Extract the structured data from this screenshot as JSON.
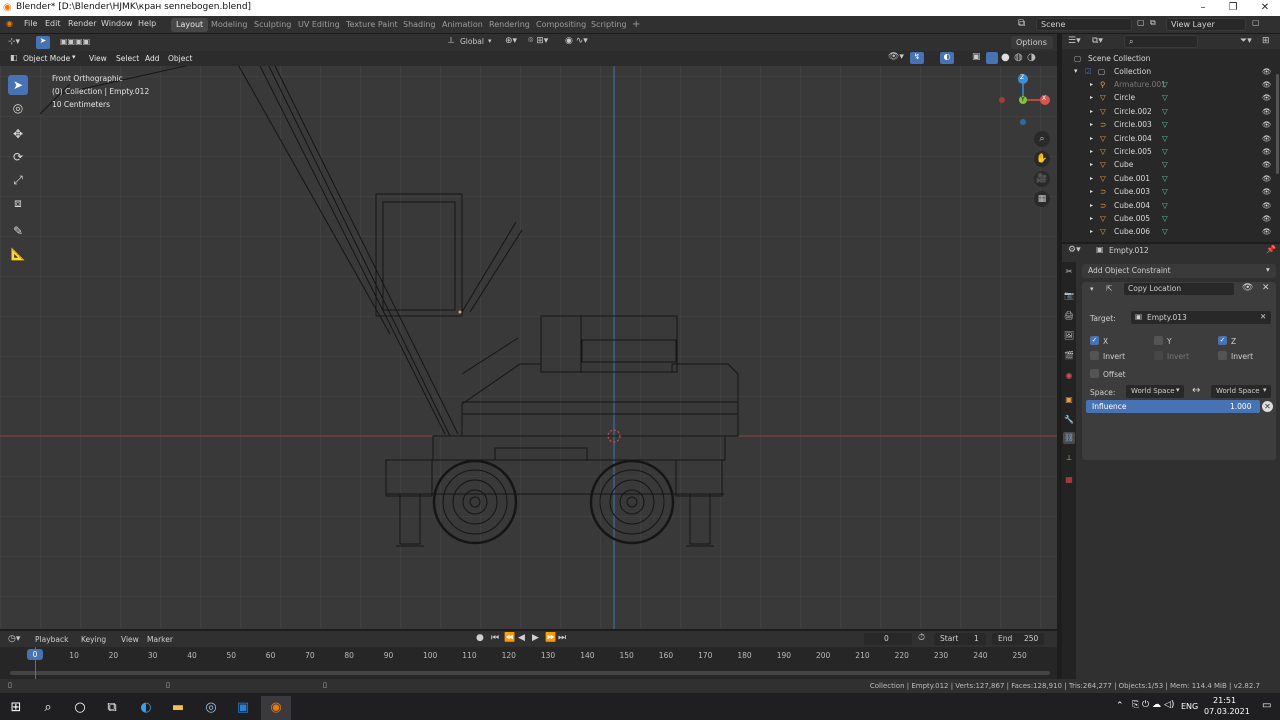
{
  "window": {
    "title": "Blender* [D:\\Blender\\HJMK\\кран sennebogen.blend]",
    "minimize": "–",
    "maximize": "❐",
    "close": "✕"
  },
  "menubar": {
    "items": [
      "File",
      "Edit",
      "Render",
      "Window",
      "Help"
    ],
    "workspaces": [
      "Layout",
      "Modeling",
      "Sculpting",
      "UV Editing",
      "Texture Paint",
      "Shading",
      "Animation",
      "Rendering",
      "Compositing",
      "Scripting"
    ],
    "active_workspace": "Layout",
    "add_workspace": "+",
    "scene": "Scene",
    "view_layer": "View Layer"
  },
  "viewport": {
    "transform_orientation": "Global",
    "options": "Options",
    "mode": "Object Mode",
    "menus": [
      "View",
      "Select",
      "Add",
      "Object"
    ],
    "overlay_lines": [
      "Front Orthographic",
      "(0) Collection | Empty.012",
      "10 Centimeters"
    ],
    "gizmo": {
      "x": "X",
      "y": "Y",
      "z": "Z"
    }
  },
  "outliner": {
    "search_placeholder": "",
    "root": "Scene Collection",
    "collection": "Collection",
    "items": [
      {
        "name": "Armature.001",
        "icon": "armature-icon",
        "dim": true
      },
      {
        "name": "Circle",
        "icon": "mesh-icon"
      },
      {
        "name": "Circle.002",
        "icon": "mesh-icon"
      },
      {
        "name": "Circle.003",
        "icon": "curve-icon"
      },
      {
        "name": "Circle.004",
        "icon": "mesh-icon"
      },
      {
        "name": "Circle.005",
        "icon": "mesh-icon"
      },
      {
        "name": "Cube",
        "icon": "mesh-icon"
      },
      {
        "name": "Cube.001",
        "icon": "mesh-icon"
      },
      {
        "name": "Cube.003",
        "icon": "curve-icon"
      },
      {
        "name": "Cube.004",
        "icon": "curve-icon"
      },
      {
        "name": "Cube.005",
        "icon": "mesh-icon"
      },
      {
        "name": "Cube.006",
        "icon": "mesh-icon"
      }
    ]
  },
  "properties": {
    "object_name": "Empty.012",
    "add_constraint": "Add Object Constraint",
    "constraint": {
      "name": "Copy Location",
      "target_label": "Target:",
      "target": "Empty.013",
      "x": "X",
      "y": "Y",
      "z": "Z",
      "x_checked": true,
      "y_checked": false,
      "z_checked": true,
      "invert": "Invert",
      "offset": "Offset",
      "space_label": "Space:",
      "owner_space": "World Space",
      "target_space": "World Space",
      "influence_label": "Influence",
      "influence": "1.000"
    }
  },
  "timeline": {
    "menus": [
      "Playback",
      "Keying",
      "View",
      "Marker"
    ],
    "current_frame": "0",
    "start_label": "Start",
    "start": "1",
    "end_label": "End",
    "end": "250",
    "ticks": [
      "0",
      "10",
      "20",
      "30",
      "40",
      "50",
      "60",
      "70",
      "80",
      "90",
      "100",
      "110",
      "120",
      "130",
      "140",
      "150",
      "160",
      "170",
      "180",
      "190",
      "200",
      "210",
      "220",
      "230",
      "240",
      "250"
    ]
  },
  "statusbar": {
    "text": "Collection | Empty.012 | Verts:127,867 | Faces:128,910 | Tris:264,277 | Objects:1/53 | Mem: 114.4 MiB | v2.82.7"
  },
  "taskbar": {
    "lang": "ENG",
    "time": "21:51",
    "date": "07.03.2021"
  },
  "colors": {
    "accent": "#4772b3",
    "x_axis": "#d9534f",
    "y_axis": "#80c442",
    "z_axis": "#3b8fd6",
    "object_orange": "#e8a24a"
  }
}
